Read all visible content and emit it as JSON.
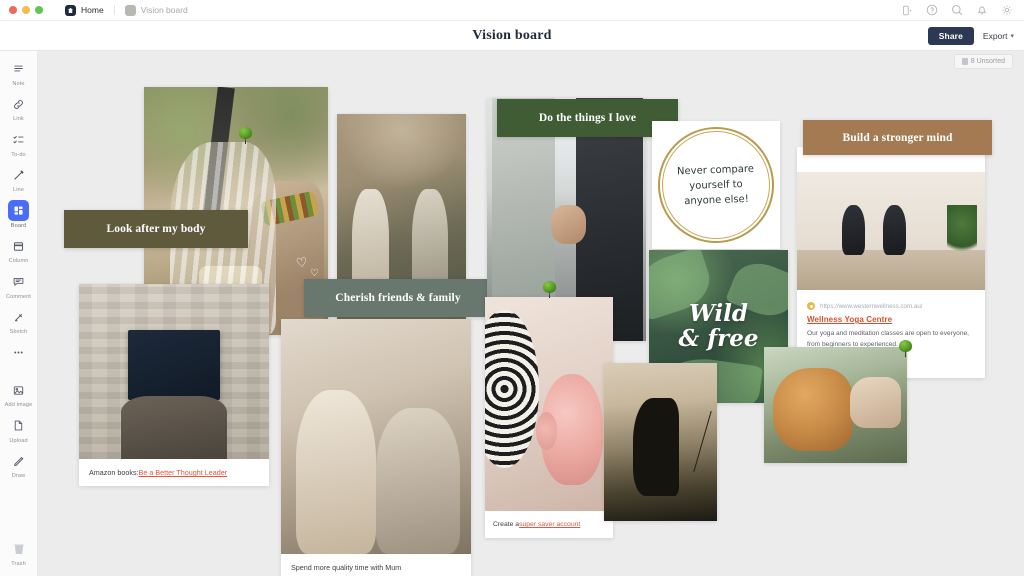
{
  "window": {
    "tabs": [
      {
        "label": "Home",
        "icon": "home-icon",
        "active": true
      },
      {
        "label": "Vision board",
        "icon": "board-thumb-icon",
        "active": false
      }
    ]
  },
  "topbar": {
    "icons": [
      {
        "name": "device-preview-icon",
        "glyph": "device"
      },
      {
        "name": "help-circle-icon",
        "glyph": "help"
      },
      {
        "name": "search-icon",
        "glyph": "search"
      },
      {
        "name": "notification-bell-icon",
        "glyph": "bell"
      },
      {
        "name": "settings-gear-icon",
        "glyph": "gear"
      }
    ]
  },
  "header": {
    "title": "Vision board",
    "share_label": "Share",
    "export_label": "Export",
    "export_caret": "▾",
    "share_color": "#2b3a52"
  },
  "sidebar": {
    "items": [
      {
        "label": "Note",
        "icon": "note-icon",
        "active": false
      },
      {
        "label": "Link",
        "icon": "link-icon",
        "active": false
      },
      {
        "label": "To-do",
        "icon": "todo-icon",
        "active": false
      },
      {
        "label": "Line",
        "icon": "line-pen-icon",
        "active": false
      },
      {
        "label": "Board",
        "icon": "board-icon",
        "active": true
      },
      {
        "label": "Column",
        "icon": "column-icon",
        "active": false
      },
      {
        "label": "Comment",
        "icon": "comment-icon",
        "active": false
      },
      {
        "label": "Sketch",
        "icon": "sketch-icon",
        "active": false
      },
      {
        "label": "",
        "icon": "more-dots-icon",
        "active": false
      },
      {
        "label": "Add image",
        "icon": "add-image-icon",
        "active": false
      },
      {
        "label": "Upload",
        "icon": "upload-icon",
        "active": false
      },
      {
        "label": "Draw",
        "icon": "draw-pencil-icon",
        "active": false
      }
    ],
    "trash": {
      "label": "Trash",
      "icon": "trash-icon"
    },
    "active_color": "#4a6cf7"
  },
  "canvas": {
    "unsorted_badge": "8 Unsorted",
    "background": "#ececec",
    "banners": [
      {
        "id": "look-after-my-body",
        "text": "Look after my body",
        "color": "#5f5a3c"
      },
      {
        "id": "cherish-friends-family",
        "text": "Cherish friends & family",
        "color": "#69786f"
      },
      {
        "id": "do-the-things-i-love",
        "text": "Do the things I love",
        "color": "#3f5c34"
      },
      {
        "id": "build-a-stronger-mind",
        "text": "Build a stronger mind",
        "color": "#a37a52"
      }
    ],
    "quote_card": {
      "lines": [
        "Never compare",
        "yourself to",
        "anyone else!"
      ],
      "ring_color": "#b99b4e"
    },
    "wild_free": {
      "line1": "Wild",
      "line2": "& free"
    },
    "captions": [
      {
        "id": "amazon-books-caption",
        "prefix": "Amazon books: ",
        "link": "Be a Better Thought Leader"
      },
      {
        "id": "super-saver-caption",
        "prefix": "Create a ",
        "link": "super saver account"
      },
      {
        "id": "mum-caption",
        "prefix": "Spend more quality time with Mum",
        "link": ""
      }
    ],
    "link_card": {
      "url": "https://www.westernwellness.com.au/",
      "title": "Wellness Yoga Centre",
      "description": "Our yoga and meditation classes are open to everyone, from beginners to experienced.",
      "title_color": "#d9502a"
    }
  }
}
